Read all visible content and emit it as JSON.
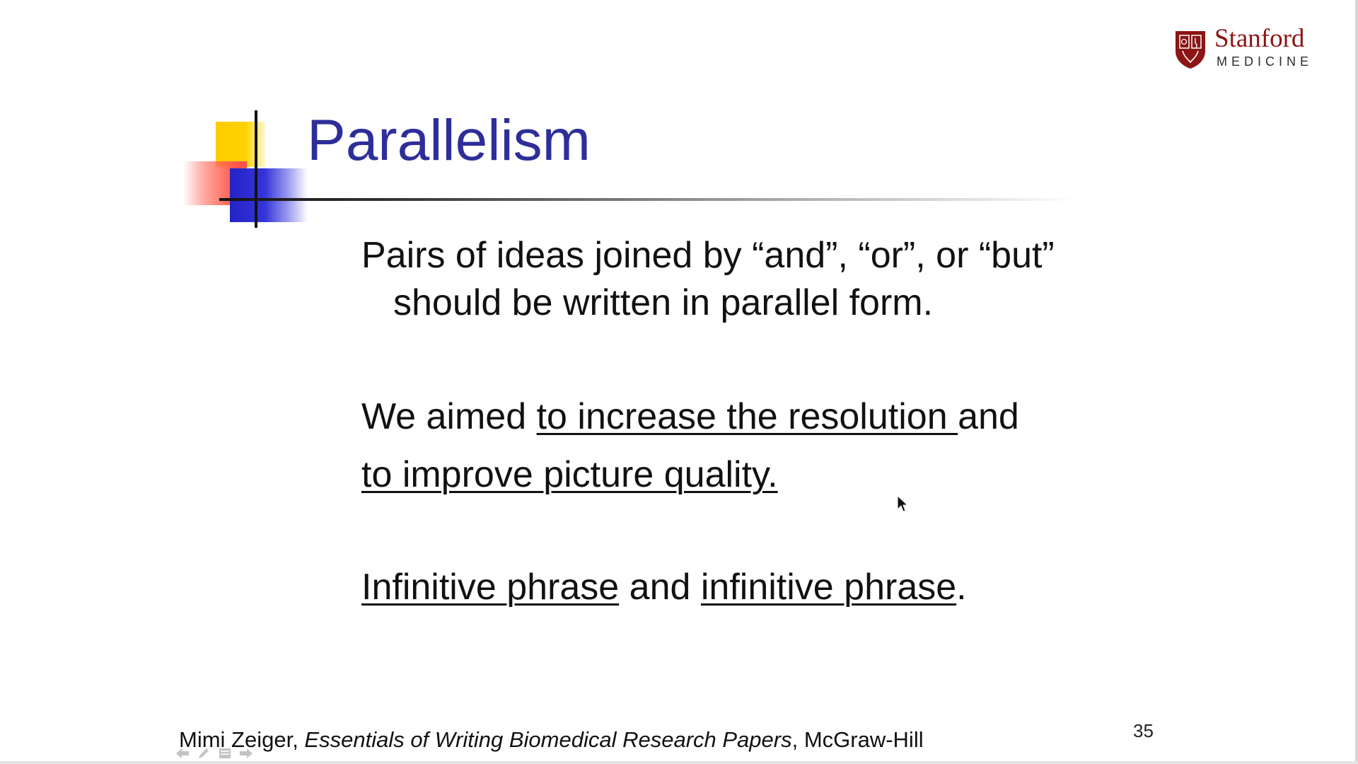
{
  "logo": {
    "name": "Stanford",
    "subname": "MEDICINE",
    "brand_color": "#8c1515"
  },
  "slide": {
    "title": "Parallelism",
    "title_color": "#2e2e9a",
    "rule": {
      "line1": "Pairs of ideas joined by  “and”, “or”, or “but”",
      "line2": "should be written in parallel form."
    },
    "example": {
      "line1_prefix": "We aimed ",
      "line1_underlined": "to increase the resolution ",
      "line1_suffix": "and",
      "line2_underlined": "to improve picture quality."
    },
    "pattern": {
      "part1": "Infinitive phrase",
      "connector": " and ",
      "part2": "infinitive phrase",
      "end": "."
    },
    "citation": {
      "author": "Mimi Zeiger, ",
      "book": "Essentials of Writing Biomedical Research Papers",
      "publisher": ", McGraw-Hill"
    },
    "page_number": "35"
  },
  "nav_controls": {
    "icons": [
      "arrow-left-icon",
      "pen-icon",
      "menu-icon",
      "arrow-right-icon"
    ]
  }
}
